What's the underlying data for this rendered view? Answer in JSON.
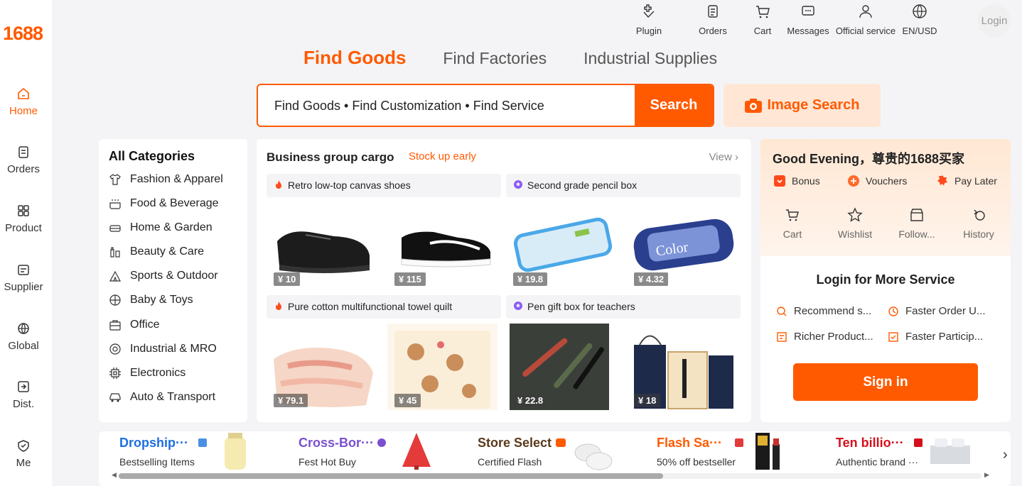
{
  "brand": {
    "logo": "1688",
    "accent": "#ff5a00"
  },
  "sidebar": {
    "items": [
      {
        "label": "Home",
        "icon": "home-icon",
        "active": true
      },
      {
        "label": "Orders",
        "icon": "orders-icon"
      },
      {
        "label": "Product",
        "icon": "product-icon"
      },
      {
        "label": "Supplier",
        "icon": "supplier-icon"
      },
      {
        "label": "Global",
        "icon": "globe-icon"
      },
      {
        "label": "Dist.",
        "icon": "distribution-icon"
      },
      {
        "label": "Me",
        "icon": "me-icon"
      }
    ]
  },
  "topnav": {
    "items": [
      {
        "label": "Plugin",
        "icon": "plugin-icon"
      },
      {
        "label": "Orders",
        "icon": "orders-icon"
      },
      {
        "label": "Cart",
        "icon": "cart-icon"
      },
      {
        "label": "Messages",
        "icon": "messages-icon"
      },
      {
        "label": "Official service",
        "icon": "service-icon"
      },
      {
        "label": "EN/USD",
        "icon": "globe-icon"
      }
    ],
    "login": "Login"
  },
  "tabs": [
    "Find Goods",
    "Find Factories",
    "Industrial Supplies"
  ],
  "search": {
    "placeholder": "Find Goods  •  Find Customization  •  Find Service",
    "button": "Search",
    "image_search": "Image Search"
  },
  "categories": {
    "title": "All Categories",
    "items": [
      "Fashion & Apparel",
      "Food & Beverage",
      "Home & Garden",
      "Beauty & Care",
      "Sports & Outdoor",
      "Baby & Toys",
      "Office",
      "Industrial & MRO",
      "Electronics",
      "Auto & Transport"
    ]
  },
  "business": {
    "title": "Business group cargo",
    "subtitle": "Stock up early",
    "view": "View",
    "cards": [
      {
        "title": "Retro low-top canvas shoes",
        "badge": "fire",
        "prices": [
          "¥ 10",
          "¥ 115"
        ]
      },
      {
        "title": "Second grade pencil box",
        "badge": "star",
        "prices": [
          "¥ 19.8",
          "¥ 4.32"
        ]
      },
      {
        "title": "Pure cotton multifunctional towel quilt",
        "badge": "fire",
        "prices": [
          "¥ 79.1",
          "¥ 45"
        ]
      },
      {
        "title": "Pen gift box for teachers",
        "badge": "star",
        "prices": [
          "¥ 22.8",
          "¥ 18"
        ]
      }
    ]
  },
  "user": {
    "greeting": "Good Evening，尊贵的1688买家",
    "perks": [
      "Bonus",
      "Vouchers",
      "Pay Later"
    ],
    "quick": [
      "Cart",
      "Wishlist",
      "Follow...",
      "History"
    ],
    "login_title": "Login for More Service",
    "services": [
      "Recommend s...",
      "Faster Order U...",
      "Richer Product...",
      "Faster Particip..."
    ],
    "signin": "Sign in"
  },
  "promos": [
    {
      "title": "Dropship···",
      "sub": "Bestselling Items",
      "color": "#1e6fe0"
    },
    {
      "title": "Cross-Bor···",
      "sub": "Fest Hot Buy",
      "color": "#7a4fd0"
    },
    {
      "title": "Store Select",
      "sub": "Certified Flash",
      "color": "#5a3a1a"
    },
    {
      "title": "Flash Sa···",
      "sub": "50% off bestseller",
      "color": "#ff5a00"
    },
    {
      "title": "Ten billio···",
      "sub": "Authentic brand ···",
      "color": "#d4101c"
    }
  ]
}
